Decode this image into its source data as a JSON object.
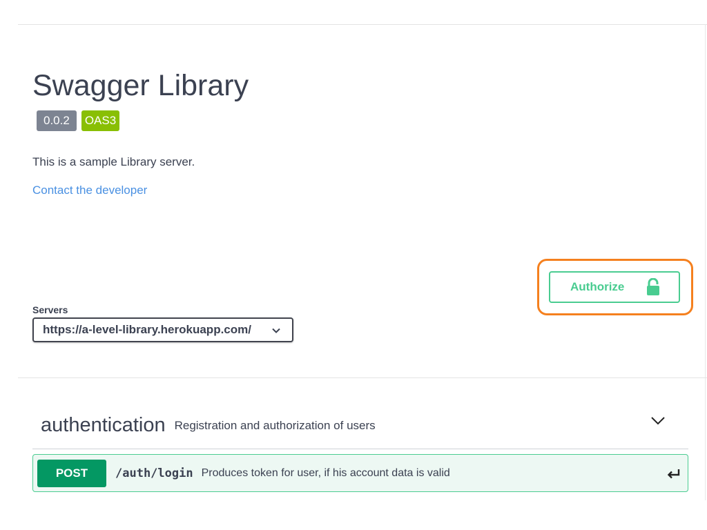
{
  "info": {
    "title": "Swagger Library",
    "version_badge": "0.0.2",
    "spec_badge": "OAS3",
    "description": "This is a sample Library server.",
    "contact_link": "Contact the developer"
  },
  "authorize": {
    "label": "Authorize",
    "icon": "lock-open-icon",
    "highlight_color": "#f5801e",
    "color": "#49cc90"
  },
  "servers": {
    "label": "Servers",
    "selected": "https://a-level-library.herokuapp.com/"
  },
  "tags": [
    {
      "name": "authentication",
      "description": "Registration and authorization of users",
      "operations": [
        {
          "method": "POST",
          "path": "/auth/login",
          "summary": "Produces token for user, if his account data is valid",
          "method_color": "#049863"
        }
      ]
    }
  ]
}
